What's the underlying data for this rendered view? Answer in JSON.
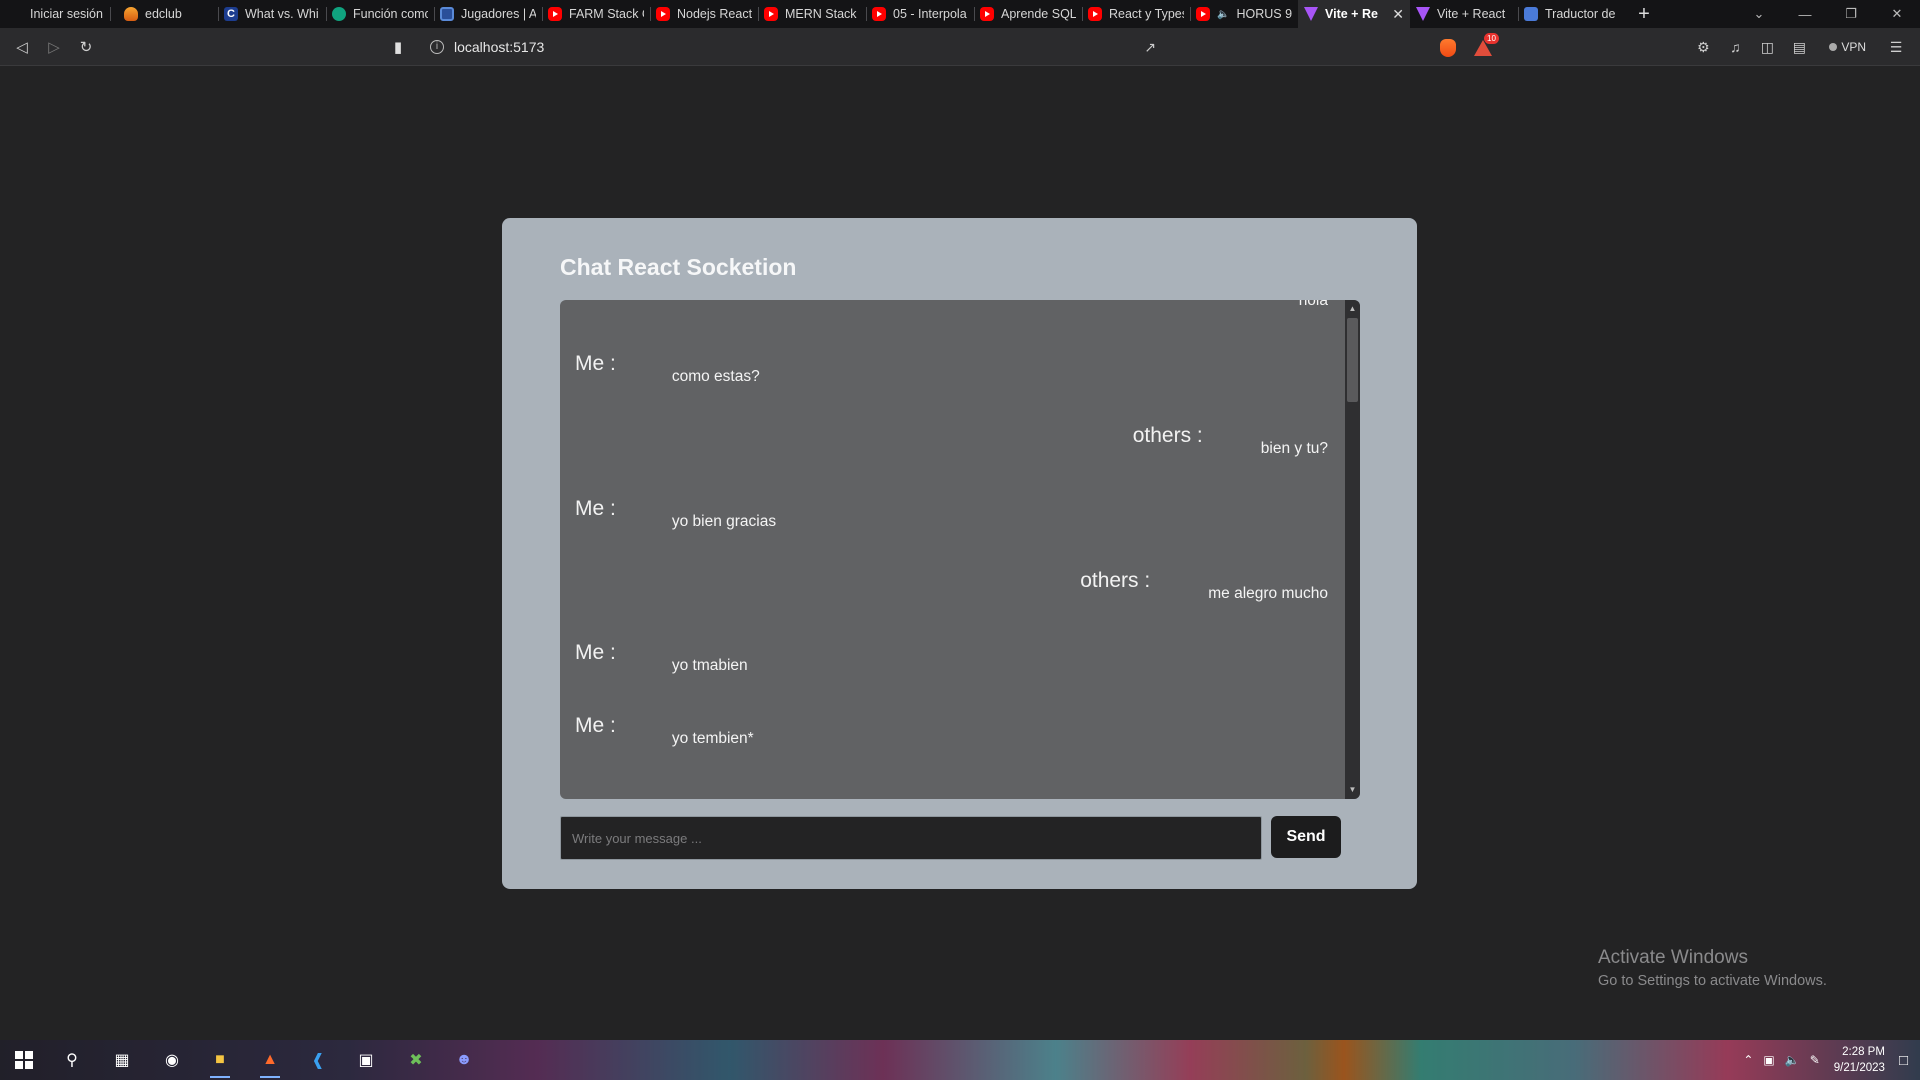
{
  "browser": {
    "tabs": [
      {
        "label": "Iniciar sesión",
        "icon": "none",
        "active": false
      },
      {
        "label": "edclub",
        "icon": "fire",
        "active": false
      },
      {
        "label": "What vs. Whi",
        "icon": "c",
        "active": false
      },
      {
        "label": "Función como",
        "icon": "gpt",
        "active": false
      },
      {
        "label": "Jugadores | A",
        "icon": "box",
        "active": false
      },
      {
        "label": "FARM Stack C",
        "icon": "yt",
        "active": false
      },
      {
        "label": "Nodejs React",
        "icon": "yt",
        "active": false
      },
      {
        "label": "MERN Stack c",
        "icon": "yt",
        "active": false
      },
      {
        "label": "05 - Interpola",
        "icon": "yt",
        "active": false
      },
      {
        "label": "Aprende SQL",
        "icon": "yt",
        "active": false
      },
      {
        "label": "React y Types",
        "icon": "yt",
        "active": false
      },
      {
        "label": "HORUS 9",
        "icon": "yt",
        "active": false,
        "audio": true
      },
      {
        "label": "Vite + Re",
        "icon": "vite",
        "active": true
      },
      {
        "label": "Vite + React",
        "icon": "vite",
        "active": false
      },
      {
        "label": "Traductor de",
        "icon": "trad",
        "active": false
      }
    ],
    "c_glyph": "C",
    "url": "localhost:5173",
    "rewards_badge": "10",
    "vpn_label": "VPN"
  },
  "app": {
    "title": "Chat React Socketion",
    "partial_message": "hola",
    "messages": [
      {
        "sender": "Me :",
        "text": "como estas?",
        "side": "me"
      },
      {
        "sender": "others :",
        "text": "bien y tu?",
        "side": "others"
      },
      {
        "sender": "Me :",
        "text": "yo bien gracias",
        "side": "me"
      },
      {
        "sender": "others :",
        "text": "me alegro mucho",
        "side": "others"
      },
      {
        "sender": "Me :",
        "text": "yo tmabien",
        "side": "me"
      },
      {
        "sender": "Me :",
        "text": "yo tembien*",
        "side": "me"
      }
    ],
    "input_placeholder": "Write your message ...",
    "input_value": "",
    "send_label": "Send"
  },
  "watermark": {
    "title": "Activate Windows",
    "subtitle": "Go to Settings to activate Windows."
  },
  "taskbar": {
    "time": "2:28 PM",
    "date": "9/21/2023",
    "notification_count": "1"
  },
  "colors": {
    "page_bg": "#232324",
    "card_bg": "#aab2ba",
    "messages_bg": "#616264",
    "send_bg": "#1c1c1d"
  }
}
